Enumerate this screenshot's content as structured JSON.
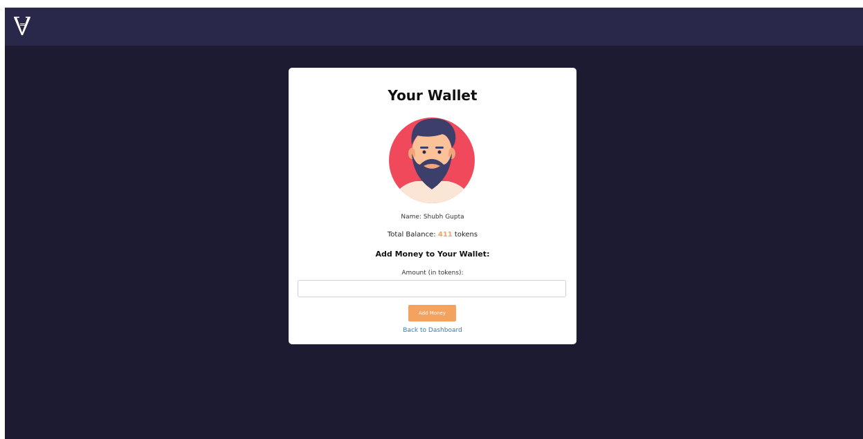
{
  "header": {
    "logo_icon": "v-monogram-logo"
  },
  "wallet": {
    "title": "Your Wallet",
    "avatar_icon": "bearded-man-avatar",
    "name_label": "Name:",
    "name_value": "Shubh Gupta",
    "balance_label": "Total Balance:",
    "balance_value": "411",
    "balance_unit": "tokens",
    "add_heading": "Add Money to Your Wallet:",
    "amount_label": "Amount (in tokens):",
    "amount_value": "",
    "add_button_label": "Add Money",
    "back_link_label": "Back to Dashboard"
  },
  "colors": {
    "page_background": "#1c1b31",
    "topbar_background": "#29284a",
    "card_background": "#ffffff",
    "accent": "#f4a25f",
    "link": "#2d7fc0",
    "avatar_circle": "#f0495b"
  }
}
